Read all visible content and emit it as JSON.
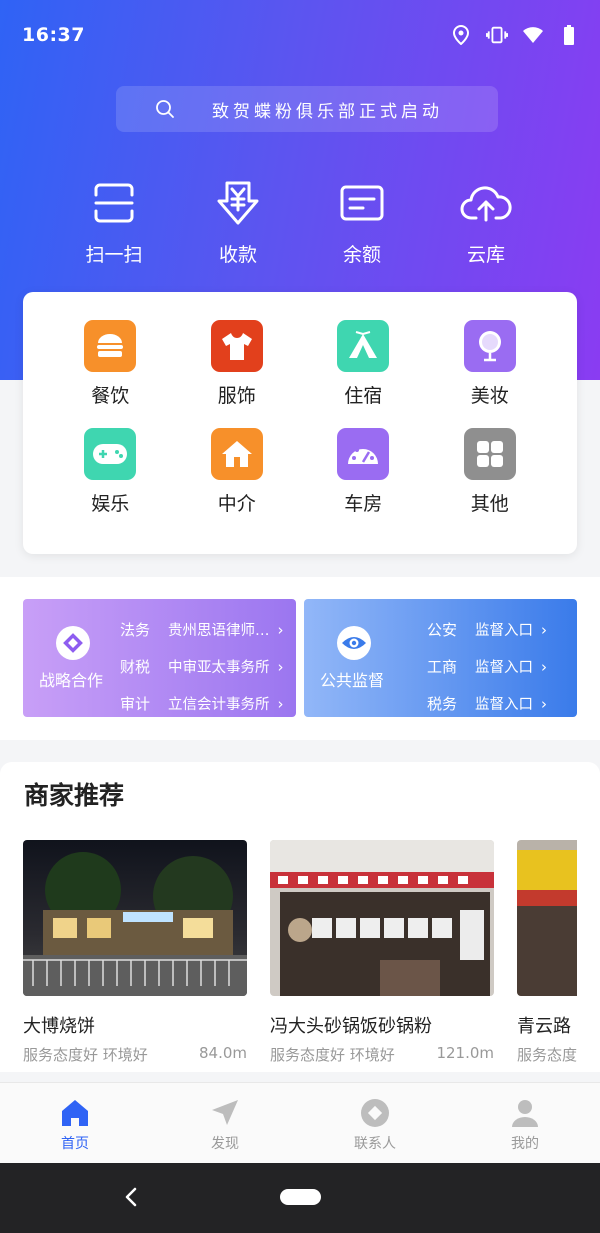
{
  "status_bar": {
    "time": "16:37",
    "icons": [
      "location-icon",
      "vibrate-icon",
      "wifi-icon",
      "battery-icon"
    ]
  },
  "search": {
    "text": "致贺蝶粉俱乐部正式启动",
    "icon": "search-icon"
  },
  "quick_actions": [
    {
      "label": "扫一扫",
      "icon": "scan-icon"
    },
    {
      "label": "收款",
      "icon": "yen-receive-icon"
    },
    {
      "label": "余额",
      "icon": "wallet-card-icon"
    },
    {
      "label": "云库",
      "icon": "cloud-upload-icon"
    }
  ],
  "categories": [
    {
      "label": "餐饮",
      "icon": "burger-icon",
      "color": "#f7902a"
    },
    {
      "label": "服饰",
      "icon": "shirt-icon",
      "color": "#e2401c"
    },
    {
      "label": "住宿",
      "icon": "tent-icon",
      "color": "#3fd6b0"
    },
    {
      "label": "美妆",
      "icon": "mirror-icon",
      "color": "#9a6cf2"
    },
    {
      "label": "娱乐",
      "icon": "gamepad-icon",
      "color": "#3fd6b0"
    },
    {
      "label": "中介",
      "icon": "house-icon",
      "color": "#f7902a"
    },
    {
      "label": "车房",
      "icon": "dashboard-icon",
      "color": "#9a6cf2"
    },
    {
      "label": "其他",
      "icon": "grid-icon",
      "color": "#8f8f8f"
    }
  ],
  "cooperation": {
    "left": {
      "title": "战略合作",
      "icon": "diamond-icon",
      "rows": [
        {
          "key": "法务",
          "value": "贵州思语律师…"
        },
        {
          "key": "财税",
          "value": "中审亚太事务所"
        },
        {
          "key": "审计",
          "value": "立信会计事务所"
        }
      ]
    },
    "right": {
      "title": "公共监督",
      "icon": "eye-icon",
      "rows": [
        {
          "key": "公安",
          "value": "监督入口"
        },
        {
          "key": "工商",
          "value": "监督入口"
        },
        {
          "key": "税务",
          "value": "监督入口"
        }
      ]
    },
    "arrow": "›"
  },
  "recommend": {
    "title": "商家推荐",
    "shops": [
      {
        "name": "大博烧饼",
        "tags": "服务态度好 环境好",
        "distance": "84.0m"
      },
      {
        "name": "冯大头砂锅饭砂锅粉",
        "tags": "服务态度好 环境好",
        "distance": "121.0m"
      },
      {
        "name": "青云路",
        "tags": "服务态度",
        "distance": ""
      }
    ]
  },
  "tabbar": [
    {
      "label": "首页",
      "icon": "home-icon",
      "active": true
    },
    {
      "label": "发现",
      "icon": "navigate-icon",
      "active": false
    },
    {
      "label": "联系人",
      "icon": "contacts-icon",
      "active": false
    },
    {
      "label": "我的",
      "icon": "user-icon",
      "active": false
    }
  ],
  "colors": {
    "accent": "#2f63f5",
    "hero_start": "#2f63f5",
    "hero_end": "#8a3cf2",
    "inactive_tab": "#9a9a9a"
  }
}
